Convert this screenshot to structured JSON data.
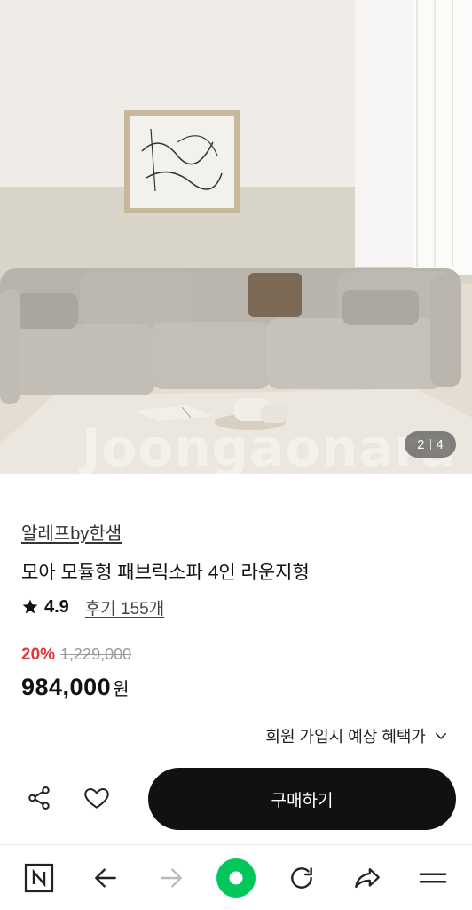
{
  "hero": {
    "watermark": "Joongaonara",
    "counter_current": "2",
    "counter_total": "4"
  },
  "product": {
    "brand": "알레프by한샘",
    "title": "모아 모듈형 패브릭소파 4인 라운지형",
    "rating": "4.9",
    "reviews": "후기 155개",
    "discount": "20%",
    "original_price": "1,229,000",
    "price": "984,000",
    "currency": "원",
    "benefit": "회원 가입시 예상 혜택가"
  },
  "actions": {
    "buy_label": "구매하기"
  },
  "icons": {
    "share": "share-icon",
    "like": "heart-icon",
    "star": "star-icon",
    "chevron": "chevron-down-icon",
    "nav": [
      "naver-n-icon",
      "back-arrow-icon",
      "forward-arrow-icon",
      "green-home-icon",
      "refresh-icon",
      "share-arrow-icon",
      "menu-icon"
    ]
  },
  "colors": {
    "discount": "#e03a3a",
    "buy_button": "#111111",
    "green_button": "#03c75a"
  }
}
